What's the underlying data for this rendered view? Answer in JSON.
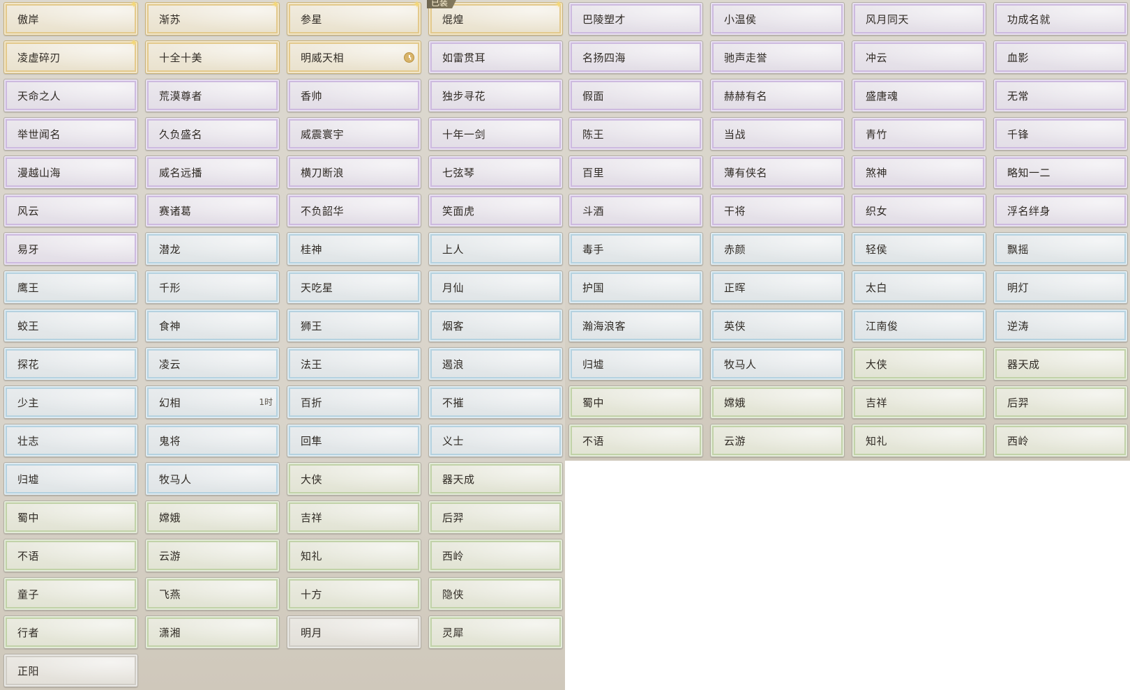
{
  "badges": {
    "equipped": "已装",
    "timer": "1时"
  },
  "left_columns": [
    [
      {
        "label": "傲岸",
        "tier": "gold",
        "sparkle": true
      },
      {
        "label": "凌虚碎刃",
        "tier": "gold",
        "sparkle": true
      },
      {
        "label": "天命之人",
        "tier": "purple"
      },
      {
        "label": "举世闻名",
        "tier": "purple"
      },
      {
        "label": "漫越山海",
        "tier": "purple"
      },
      {
        "label": "风云",
        "tier": "purple"
      },
      {
        "label": "易牙",
        "tier": "purple"
      },
      {
        "label": "鹰王",
        "tier": "blue"
      },
      {
        "label": "蛟王",
        "tier": "blue"
      },
      {
        "label": "探花",
        "tier": "blue"
      },
      {
        "label": "少主",
        "tier": "blue"
      },
      {
        "label": "壮志",
        "tier": "blue"
      },
      {
        "label": "归墟",
        "tier": "blue"
      },
      {
        "label": "蜀中",
        "tier": "green"
      },
      {
        "label": "不语",
        "tier": "green"
      },
      {
        "label": "童子",
        "tier": "green"
      },
      {
        "label": "行者",
        "tier": "green"
      },
      {
        "label": "正阳",
        "tier": "gray"
      }
    ],
    [
      {
        "label": "渐苏",
        "tier": "gold",
        "sparkle": true
      },
      {
        "label": "十全十美",
        "tier": "gold"
      },
      {
        "label": "荒漠尊者",
        "tier": "purple"
      },
      {
        "label": "久负盛名",
        "tier": "purple"
      },
      {
        "label": "威名远播",
        "tier": "purple"
      },
      {
        "label": "赛诸葛",
        "tier": "purple"
      },
      {
        "label": "潜龙",
        "tier": "blue"
      },
      {
        "label": "千形",
        "tier": "blue"
      },
      {
        "label": "食神",
        "tier": "blue"
      },
      {
        "label": "凌云",
        "tier": "blue"
      },
      {
        "label": "幻相",
        "tier": "blue",
        "timer": true
      },
      {
        "label": "鬼将",
        "tier": "blue"
      },
      {
        "label": "牧马人",
        "tier": "blue"
      },
      {
        "label": "嫦娥",
        "tier": "green"
      },
      {
        "label": "云游",
        "tier": "green"
      },
      {
        "label": "飞燕",
        "tier": "green"
      },
      {
        "label": "潇湘",
        "tier": "green"
      }
    ],
    [
      {
        "label": "参星",
        "tier": "gold",
        "sparkle": true
      },
      {
        "label": "明威天相",
        "tier": "gold",
        "clock": true
      },
      {
        "label": "香帅",
        "tier": "purple"
      },
      {
        "label": "威震寰宇",
        "tier": "purple"
      },
      {
        "label": "横刀断浪",
        "tier": "purple"
      },
      {
        "label": "不负韶华",
        "tier": "purple"
      },
      {
        "label": "桂神",
        "tier": "blue"
      },
      {
        "label": "天吃星",
        "tier": "blue"
      },
      {
        "label": "狮王",
        "tier": "blue"
      },
      {
        "label": "法王",
        "tier": "blue"
      },
      {
        "label": "百折",
        "tier": "blue"
      },
      {
        "label": "回隼",
        "tier": "blue"
      },
      {
        "label": "大侠",
        "tier": "green"
      },
      {
        "label": "吉祥",
        "tier": "green"
      },
      {
        "label": "知礼",
        "tier": "green"
      },
      {
        "label": "十方",
        "tier": "green"
      },
      {
        "label": "明月",
        "tier": "gray"
      }
    ],
    [
      {
        "label": "焜煌",
        "tier": "gold",
        "sparkle": true,
        "equipped": true
      },
      {
        "label": "如雷贯耳",
        "tier": "purple"
      },
      {
        "label": "独步寻花",
        "tier": "purple"
      },
      {
        "label": "十年一剑",
        "tier": "purple"
      },
      {
        "label": "七弦琴",
        "tier": "purple"
      },
      {
        "label": "笑面虎",
        "tier": "purple"
      },
      {
        "label": "上人",
        "tier": "blue"
      },
      {
        "label": "月仙",
        "tier": "blue"
      },
      {
        "label": "烟客",
        "tier": "blue"
      },
      {
        "label": "遏浪",
        "tier": "blue"
      },
      {
        "label": "不摧",
        "tier": "blue"
      },
      {
        "label": "义士",
        "tier": "blue"
      },
      {
        "label": "器天成",
        "tier": "green"
      },
      {
        "label": "后羿",
        "tier": "green"
      },
      {
        "label": "西岭",
        "tier": "green"
      },
      {
        "label": "隐侠",
        "tier": "green"
      },
      {
        "label": "灵犀",
        "tier": "green"
      }
    ]
  ],
  "right_columns": [
    [
      {
        "label": "巴陵塑才",
        "tier": "purple"
      },
      {
        "label": "名扬四海",
        "tier": "purple"
      },
      {
        "label": "假面",
        "tier": "purple"
      },
      {
        "label": "陈王",
        "tier": "purple"
      },
      {
        "label": "百里",
        "tier": "purple"
      },
      {
        "label": "斗酒",
        "tier": "purple"
      },
      {
        "label": "毒手",
        "tier": "blue"
      },
      {
        "label": "护国",
        "tier": "blue"
      },
      {
        "label": "瀚海浪客",
        "tier": "blue"
      },
      {
        "label": "归墟",
        "tier": "blue"
      },
      {
        "label": "蜀中",
        "tier": "green"
      },
      {
        "label": "不语",
        "tier": "green"
      }
    ],
    [
      {
        "label": "小温侯",
        "tier": "purple"
      },
      {
        "label": "驰声走誉",
        "tier": "purple"
      },
      {
        "label": "赫赫有名",
        "tier": "purple"
      },
      {
        "label": "当战",
        "tier": "purple"
      },
      {
        "label": "薄有侠名",
        "tier": "purple"
      },
      {
        "label": "干将",
        "tier": "purple"
      },
      {
        "label": "赤颜",
        "tier": "blue"
      },
      {
        "label": "正晖",
        "tier": "blue"
      },
      {
        "label": "英侠",
        "tier": "blue"
      },
      {
        "label": "牧马人",
        "tier": "blue"
      },
      {
        "label": "嫦娥",
        "tier": "green"
      },
      {
        "label": "云游",
        "tier": "green"
      }
    ],
    [
      {
        "label": "风月同天",
        "tier": "purple"
      },
      {
        "label": "冲云",
        "tier": "purple"
      },
      {
        "label": "盛唐魂",
        "tier": "purple"
      },
      {
        "label": "青竹",
        "tier": "purple"
      },
      {
        "label": "煞神",
        "tier": "purple"
      },
      {
        "label": "织女",
        "tier": "purple"
      },
      {
        "label": "轻侯",
        "tier": "blue"
      },
      {
        "label": "太白",
        "tier": "blue"
      },
      {
        "label": "江南俊",
        "tier": "blue"
      },
      {
        "label": "大侠",
        "tier": "green"
      },
      {
        "label": "吉祥",
        "tier": "green"
      },
      {
        "label": "知礼",
        "tier": "green"
      }
    ],
    [
      {
        "label": "功成名就",
        "tier": "purple"
      },
      {
        "label": "血影",
        "tier": "purple"
      },
      {
        "label": "无常",
        "tier": "purple"
      },
      {
        "label": "千锋",
        "tier": "purple"
      },
      {
        "label": "略知一二",
        "tier": "purple"
      },
      {
        "label": "浮名绊身",
        "tier": "purple"
      },
      {
        "label": "飘摇",
        "tier": "blue"
      },
      {
        "label": "明灯",
        "tier": "blue"
      },
      {
        "label": "逆涛",
        "tier": "blue"
      },
      {
        "label": "器天成",
        "tier": "green"
      },
      {
        "label": "后羿",
        "tier": "green"
      },
      {
        "label": "西岭",
        "tier": "green"
      }
    ]
  ]
}
